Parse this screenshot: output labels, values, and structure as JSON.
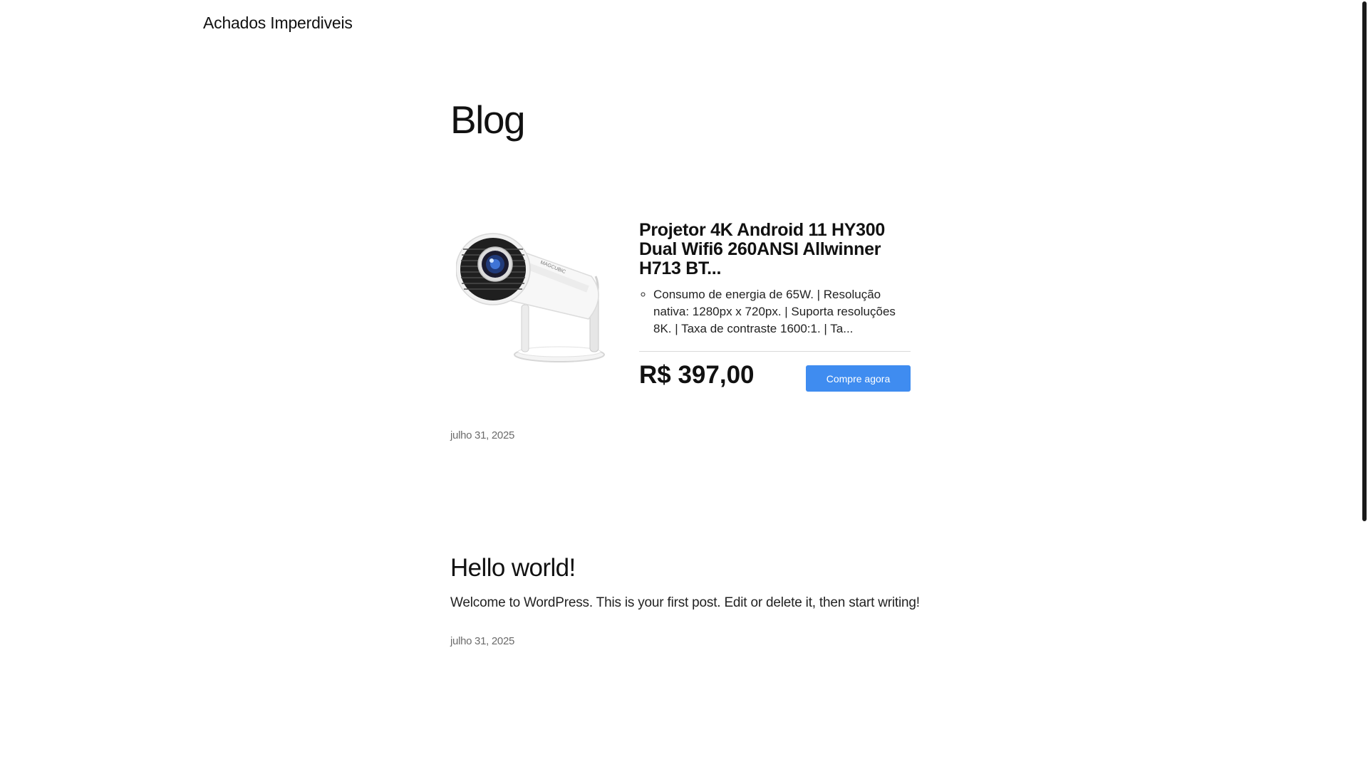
{
  "site": {
    "title": "Achados Imperdiveis"
  },
  "page": {
    "heading": "Blog"
  },
  "product": {
    "image_alt": "projector-image",
    "brand_marking": "MAGCUBIC",
    "title": "Projetor 4K Android 11 HY300 Dual Wifi6 260ANSI Allwinner H713 BT...",
    "description": "Consumo de energia de 65W. | Resolução nativa: 1280px x 720px. | Suporta resoluções 8K. | Taxa de contraste 1600:1. | Ta...",
    "price": "R$ 397,00",
    "button_label": "Compre agora",
    "date": "julho 31, 2025"
  },
  "post": {
    "title": "Hello world!",
    "excerpt": "Welcome to WordPress. This is your first post. Edit or delete it, then start writing!",
    "date": "julho 31, 2025"
  },
  "colors": {
    "button_bg": "#3f8cf0",
    "text": "#111111",
    "date_text": "#6b6b6b"
  }
}
